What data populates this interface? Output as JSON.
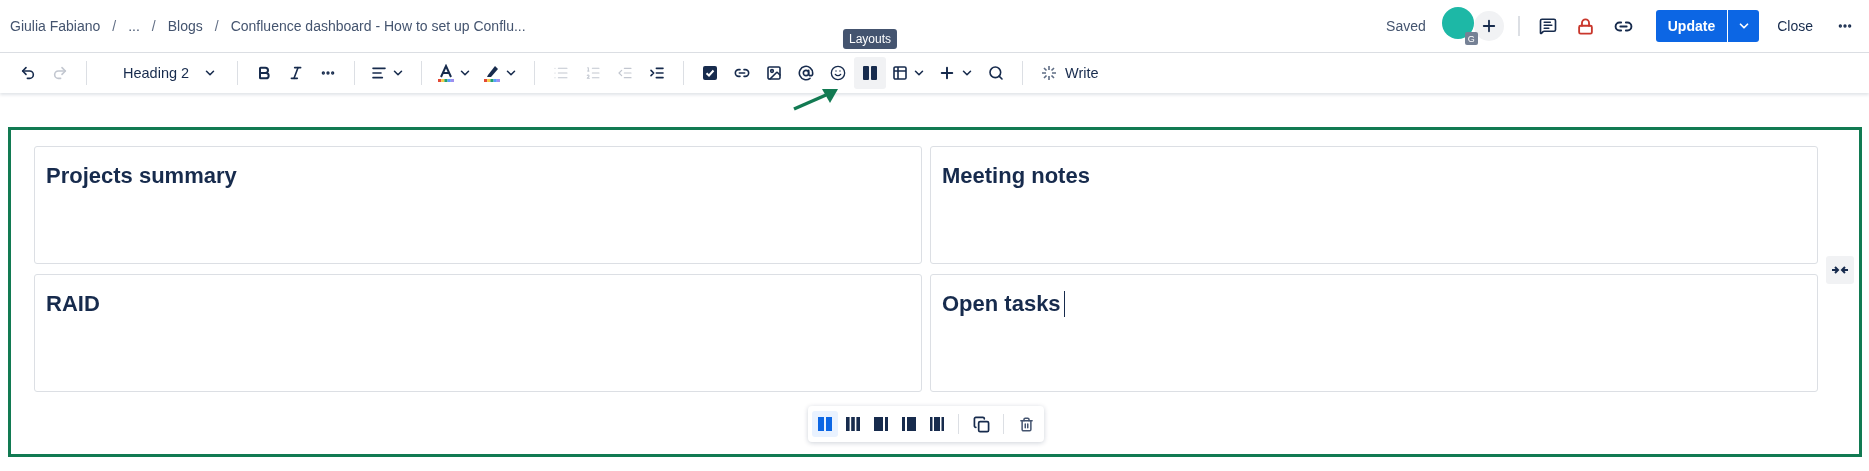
{
  "breadcrumbs": [
    {
      "kind": "link",
      "label": "Giulia Fabiano"
    },
    {
      "kind": "separator",
      "label": "/"
    },
    {
      "kind": "link",
      "label": "..."
    },
    {
      "kind": "separator",
      "label": "/"
    },
    {
      "kind": "link",
      "label": "Blogs"
    },
    {
      "kind": "separator",
      "label": "/"
    },
    {
      "kind": "link",
      "label": "Confluence dashboard - How to set up Conflu..."
    }
  ],
  "status": "Saved",
  "avatar": {
    "badge": "G"
  },
  "actions": {
    "update": "Update",
    "close": "Close"
  },
  "toolbar": [
    {
      "items": [
        {
          "kind": "undo",
          "disabled": false,
          "dropdown": false,
          "highlighted": false
        },
        {
          "kind": "redo",
          "disabled": true,
          "dropdown": false,
          "highlighted": false
        }
      ]
    },
    {
      "items": [
        {
          "kind": "text-style",
          "label": "Heading 2",
          "disabled": false,
          "dropdown": true,
          "highlighted": false
        }
      ]
    },
    {
      "items": [
        {
          "kind": "bold",
          "disabled": false,
          "dropdown": false,
          "highlighted": false
        },
        {
          "kind": "italic",
          "disabled": false,
          "dropdown": false,
          "highlighted": false
        },
        {
          "kind": "more",
          "disabled": false,
          "dropdown": false,
          "highlighted": false
        }
      ]
    },
    {
      "items": [
        {
          "kind": "align",
          "disabled": false,
          "dropdown": true,
          "highlighted": false
        }
      ]
    },
    {
      "items": [
        {
          "kind": "text-color",
          "disabled": false,
          "dropdown": true,
          "highlighted": false
        },
        {
          "kind": "highlight",
          "disabled": false,
          "dropdown": true,
          "highlighted": false
        }
      ]
    },
    {
      "items": [
        {
          "kind": "bullet-list",
          "disabled": true,
          "dropdown": false,
          "highlighted": false
        },
        {
          "kind": "numbered-list",
          "disabled": true,
          "dropdown": false,
          "highlighted": false
        },
        {
          "kind": "outdent",
          "disabled": true,
          "dropdown": false,
          "highlighted": false
        },
        {
          "kind": "indent",
          "disabled": false,
          "dropdown": false,
          "highlighted": false
        }
      ]
    },
    {
      "items": [
        {
          "kind": "task",
          "disabled": false,
          "dropdown": false,
          "highlighted": false
        },
        {
          "kind": "link",
          "disabled": false,
          "dropdown": false,
          "highlighted": false
        },
        {
          "kind": "image",
          "disabled": false,
          "dropdown": false,
          "highlighted": false
        },
        {
          "kind": "mention",
          "disabled": false,
          "dropdown": false,
          "highlighted": false
        },
        {
          "kind": "emoji",
          "disabled": false,
          "dropdown": false,
          "highlighted": false
        },
        {
          "kind": "layouts",
          "disabled": false,
          "dropdown": false,
          "highlighted": true,
          "tooltip": "Layouts"
        },
        {
          "kind": "table",
          "disabled": false,
          "dropdown": true,
          "highlighted": false
        },
        {
          "kind": "insert",
          "disabled": false,
          "dropdown": true,
          "highlighted": false
        },
        {
          "kind": "search",
          "disabled": false,
          "dropdown": false,
          "highlighted": false
        }
      ]
    },
    {
      "items": [
        {
          "kind": "write",
          "label": "Write",
          "disabled": false,
          "dropdown": false,
          "highlighted": false
        }
      ]
    }
  ],
  "layout": {
    "cells": [
      {
        "heading": "Projects summary",
        "cursor": false
      },
      {
        "heading": "Meeting notes",
        "cursor": false
      },
      {
        "heading": "RAID",
        "cursor": false
      },
      {
        "heading": "Open tasks",
        "cursor": true
      }
    ],
    "options": [
      {
        "kind": "two-equal",
        "selected": true
      },
      {
        "kind": "three-equal",
        "selected": false
      },
      {
        "kind": "right-sidebar",
        "selected": false
      },
      {
        "kind": "left-sidebar",
        "selected": false
      },
      {
        "kind": "three-sidebars",
        "selected": false
      }
    ]
  }
}
